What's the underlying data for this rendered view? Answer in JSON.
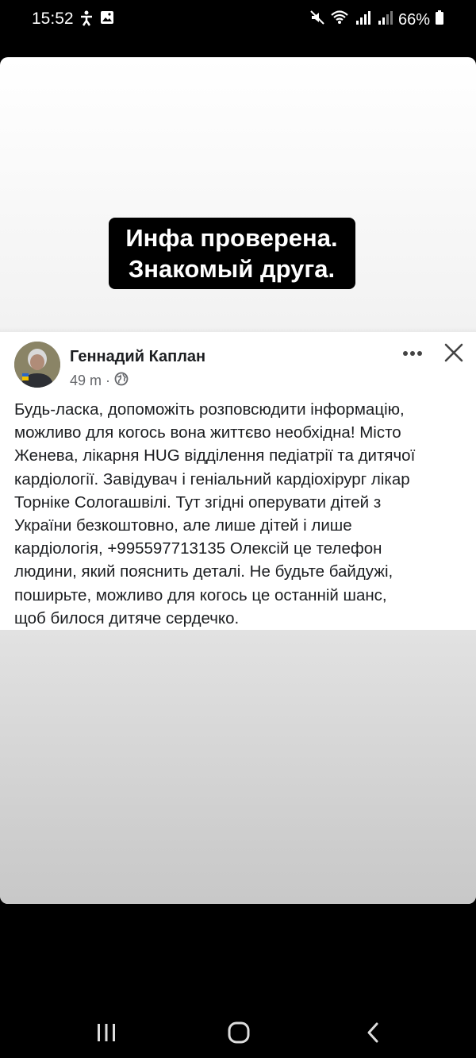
{
  "status_bar": {
    "time": "15:52",
    "battery": "66%",
    "icons": [
      "accessibility-icon",
      "gallery-icon",
      "mute-icon",
      "wifi-icon",
      "signal-icon",
      "signal-icon",
      "battery-icon"
    ]
  },
  "caption": {
    "line1": "Инфа проверена.",
    "line2": "Знакомый друга."
  },
  "post": {
    "author": "Геннадий Каплан",
    "time": "49 m",
    "separator": "·",
    "privacy_icon": "globe-icon",
    "text": "Будь-ласка, допоможіть розповсюдити інформацію,\nможливо для когось вона життєво необхідна! Місто\nЖенева, лікарня HUG відділення педіатрії та дитячої\nкардіології. Завідувач і геніальний кардіохірург лікар\nТорніке Сологашвілі. Тут згідні оперувати дітей з\nУкраїни безкоштовно, але лише дітей і лише\nкардіологія, +995597713135 Олексій це телефон\nлюдини, який пояснить деталі. Не будьте байдужі,\nпоширьте, можливо для когось це останній шанс,\nщоб билося дитяче сердечко."
  },
  "nav_bar": {
    "icons": [
      "recents-icon",
      "home-icon",
      "back-icon"
    ]
  }
}
